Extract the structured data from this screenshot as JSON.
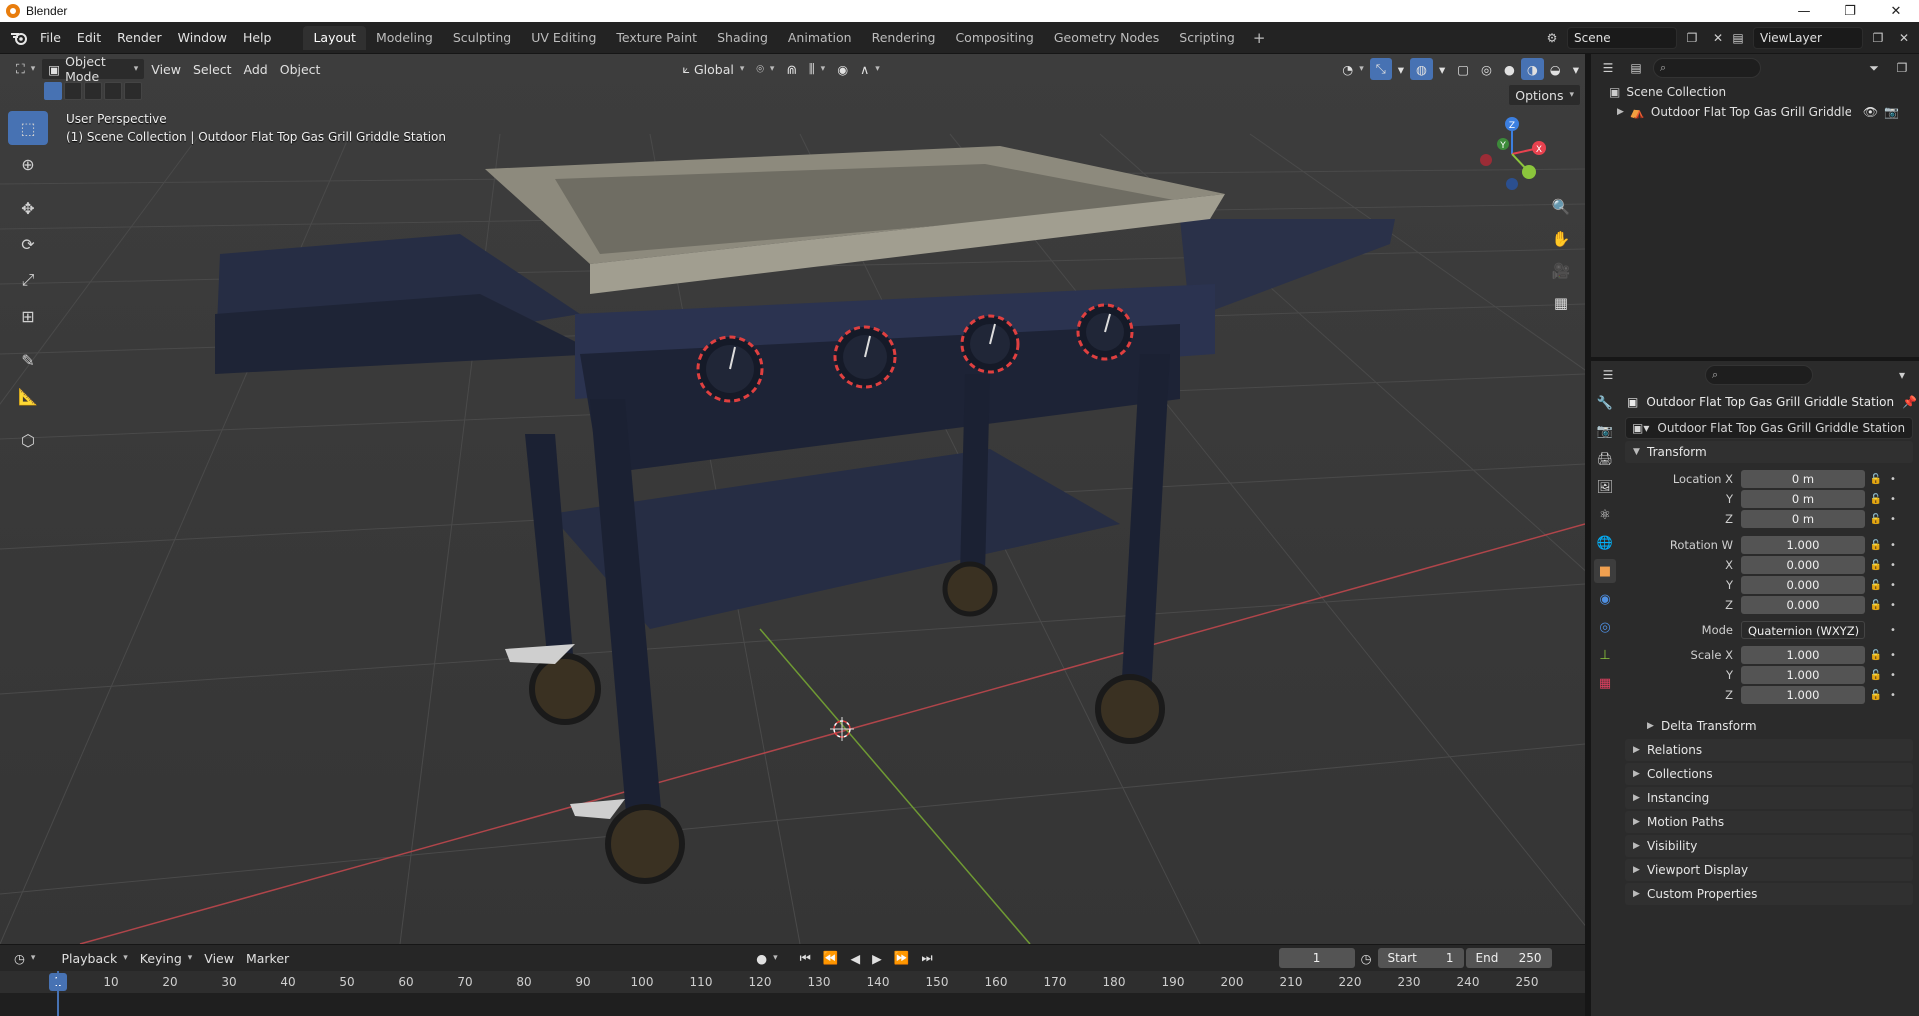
{
  "window": {
    "title": "Blender",
    "minimize": "—",
    "maximize": "❐",
    "close": "✕"
  },
  "menu": {
    "file": "File",
    "edit": "Edit",
    "render": "Render",
    "window": "Window",
    "help": "Help"
  },
  "workspaces": [
    "Layout",
    "Modeling",
    "Sculpting",
    "UV Editing",
    "Texture Paint",
    "Shading",
    "Animation",
    "Rendering",
    "Compositing",
    "Geometry Nodes",
    "Scripting"
  ],
  "workspace_add": "+",
  "scene": {
    "name": "Scene",
    "view_layer": "ViewLayer"
  },
  "viewport": {
    "mode": "Object Mode",
    "menus": [
      "View",
      "Select",
      "Add",
      "Object"
    ],
    "orientation": "Global",
    "options": "Options",
    "info_line1": "User Perspective",
    "info_line2": "(1) Scene Collection | Outdoor Flat Top Gas Grill Griddle Station"
  },
  "outliner": {
    "root": "Scene Collection",
    "object": "Outdoor Flat Top Gas Grill Griddle Station"
  },
  "properties": {
    "object_name": "Outdoor Flat Top Gas Grill Griddle Station",
    "data_name": "Outdoor Flat Top Gas Grill Griddle Station",
    "transform_title": "Transform",
    "location": {
      "label": "Location X",
      "x": "0 m",
      "y": "0 m",
      "z": "0 m"
    },
    "rotation": {
      "label": "Rotation W",
      "w": "1.000",
      "x": "0.000",
      "y": "0.000",
      "z": "0.000"
    },
    "mode_label": "Mode",
    "mode_value": "Quaternion (WXYZ)",
    "scale": {
      "label": "Scale X",
      "x": "1.000",
      "y": "1.000",
      "z": "1.000"
    },
    "axis_y": "Y",
    "axis_x": "X",
    "axis_z": "Z",
    "delta": "Delta Transform",
    "sections": [
      "Relations",
      "Collections",
      "Instancing",
      "Motion Paths",
      "Visibility",
      "Viewport Display",
      "Custom Properties"
    ]
  },
  "timeline": {
    "menus": [
      "Playback",
      "Keying",
      "View",
      "Marker"
    ],
    "current_frame": "1",
    "start_label": "Start",
    "start": "1",
    "end_label": "End",
    "end": "250",
    "ruler": [
      "10",
      "20",
      "30",
      "40",
      "50",
      "60",
      "70",
      "80",
      "90",
      "100",
      "110",
      "120",
      "130",
      "140",
      "150",
      "160",
      "170",
      "180",
      "190",
      "200",
      "210",
      "220",
      "230",
      "240",
      "250"
    ],
    "ruler_current": "1"
  },
  "gizmo": {
    "x": "X",
    "y": "Y",
    "z": "Z"
  },
  "colors": {
    "accent": "#4772b3",
    "x_axis": "#e8424f",
    "y_axis": "#8bc53c",
    "z_axis": "#3c7fe0"
  }
}
